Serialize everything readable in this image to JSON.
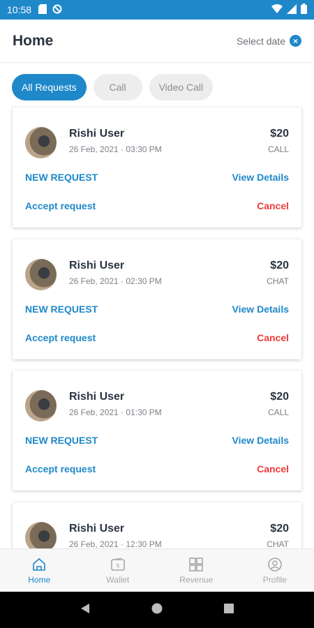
{
  "status_bar": {
    "time": "10:58"
  },
  "header": {
    "title": "Home",
    "select_date_label": "Select date"
  },
  "filters": [
    {
      "label": "All Requests",
      "active": true
    },
    {
      "label": "Call",
      "active": false
    },
    {
      "label": "Video Call",
      "active": false
    }
  ],
  "requests": [
    {
      "name": "Rishi User",
      "datetime": "26 Feb, 2021 · 03:30 PM",
      "price": "$20",
      "type": "CALL",
      "status": "NEW REQUEST",
      "details_label": "View Details",
      "accept_label": "Accept request",
      "cancel_label": "Cancel"
    },
    {
      "name": "Rishi User",
      "datetime": "26 Feb, 2021 · 02:30 PM",
      "price": "$20",
      "type": "CHAT",
      "status": "NEW REQUEST",
      "details_label": "View Details",
      "accept_label": "Accept request",
      "cancel_label": "Cancel"
    },
    {
      "name": "Rishi User",
      "datetime": "26 Feb, 2021 · 01:30 PM",
      "price": "$20",
      "type": "CALL",
      "status": "NEW REQUEST",
      "details_label": "View Details",
      "accept_label": "Accept request",
      "cancel_label": "Cancel"
    },
    {
      "name": "Rishi User",
      "datetime": "26 Feb, 2021 · 12:30 PM",
      "price": "$20",
      "type": "CHAT",
      "status": "",
      "details_label": "",
      "accept_label": "",
      "cancel_label": ""
    }
  ],
  "bottom_nav": [
    {
      "label": "Home",
      "icon": "home-icon",
      "active": true
    },
    {
      "label": "Wallet",
      "icon": "wallet-icon",
      "active": false
    },
    {
      "label": "Revenue",
      "icon": "revenue-icon",
      "active": false
    },
    {
      "label": "Profile",
      "icon": "profile-icon",
      "active": false
    }
  ],
  "colors": {
    "accent": "#1f88c9",
    "danger": "#ef3b3b"
  }
}
